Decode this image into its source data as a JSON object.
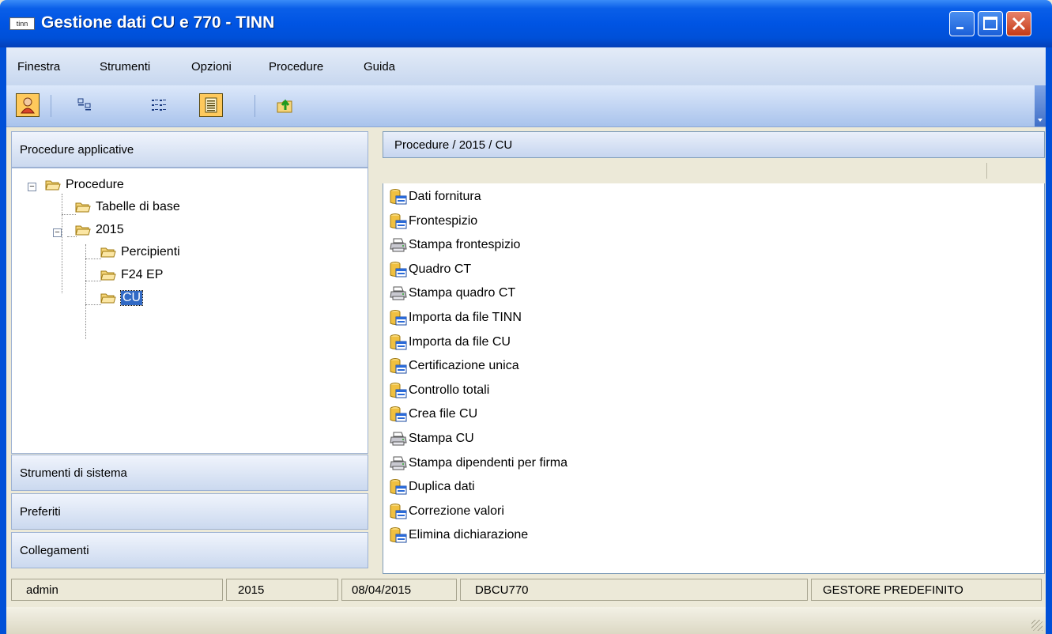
{
  "window": {
    "title": "Gestione dati CU e 770 - TINN",
    "icon_label": "tinn",
    "controls": [
      "minimize-icon",
      "maximize-icon",
      "close-icon"
    ]
  },
  "menu": [
    "Finestra",
    "Strumenti",
    "Opzioni",
    "Procedure",
    "Guida"
  ],
  "toolbar": {
    "buttons": [
      "user-icon",
      "large-icons-icon",
      "small-icons-icon",
      "details-icon",
      "folder-up-icon"
    ],
    "active": [
      "user-icon",
      "details-icon"
    ]
  },
  "left_panel": {
    "header": "Procedure applicative",
    "tree": {
      "root": "Procedure",
      "child1": "Tabelle di base",
      "year": "2015",
      "sub1": "Percipienti",
      "sub2": "F24 EP",
      "sub3": "CU"
    },
    "sections": [
      "Strumenti di sistema",
      "Preferiti",
      "Collegamenti"
    ]
  },
  "right_panel": {
    "breadcrumb": "Procedure / 2015 / CU",
    "items": [
      {
        "label": "Dati fornitura",
        "icon": "database-form-icon"
      },
      {
        "label": "Frontespizio",
        "icon": "database-form-icon"
      },
      {
        "label": "Stampa frontespizio",
        "icon": "printer-icon"
      },
      {
        "label": "Quadro CT",
        "icon": "database-form-icon"
      },
      {
        "label": "Stampa quadro CT",
        "icon": "printer-icon"
      },
      {
        "label": "Importa da file TINN",
        "icon": "database-form-icon"
      },
      {
        "label": "Importa da file CU",
        "icon": "database-form-icon"
      },
      {
        "label": "Certificazione unica",
        "icon": "database-form-icon"
      },
      {
        "label": "Controllo totali",
        "icon": "database-form-icon"
      },
      {
        "label": "Crea file CU",
        "icon": "database-form-icon"
      },
      {
        "label": "Stampa CU",
        "icon": "printer-icon"
      },
      {
        "label": "Stampa dipendenti per firma",
        "icon": "printer-icon"
      },
      {
        "label": "Duplica dati",
        "icon": "database-form-icon"
      },
      {
        "label": "Correzione valori",
        "icon": "database-form-icon"
      },
      {
        "label": "Elimina dichiarazione",
        "icon": "database-form-icon"
      }
    ]
  },
  "status": {
    "user": "admin",
    "year": "2015",
    "date": "08/04/2015",
    "db": "DBCU770",
    "manager": "GESTORE PREDEFINITO"
  },
  "colors": {
    "titlebar": "#0054e3",
    "selection": "#316ac5",
    "folder": "#f5d57a",
    "active_tool": "#fec95c"
  }
}
